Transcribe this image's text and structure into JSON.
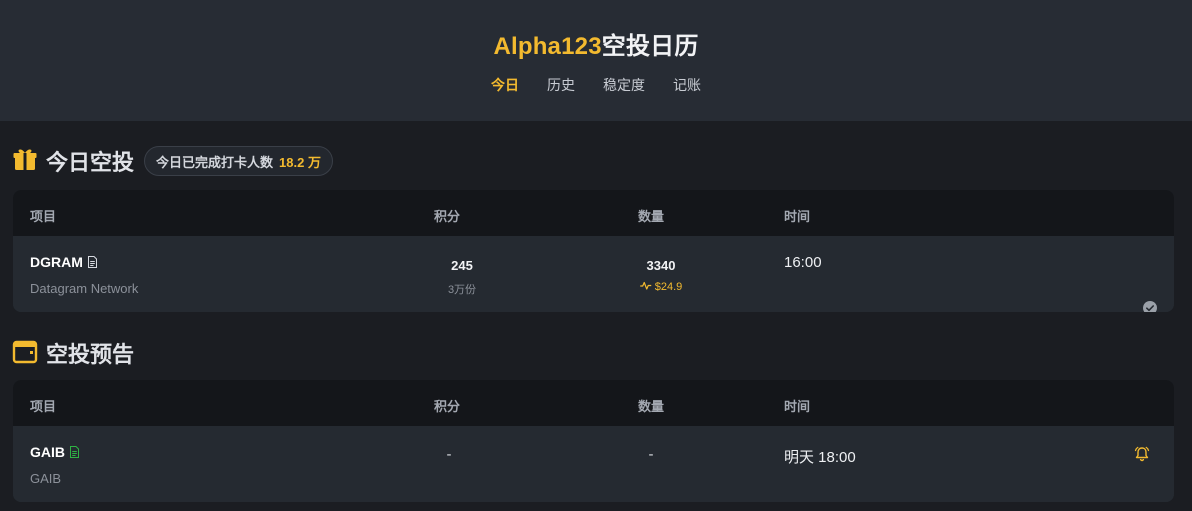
{
  "header": {
    "brand_accent": "Alpha123",
    "brand_rest": "空投日历",
    "tabs": [
      {
        "label": "今日",
        "active": true
      },
      {
        "label": "历史",
        "active": false
      },
      {
        "label": "稳定度",
        "active": false
      },
      {
        "label": "记账",
        "active": false
      }
    ]
  },
  "today": {
    "title": "今日空投",
    "icon": "gift-icon",
    "badge_label": "今日已完成打卡人数",
    "badge_value": "18.2 万",
    "columns": [
      "项目",
      "积分",
      "数量",
      "时间"
    ],
    "rows": [
      {
        "symbol": "DGRAM",
        "name": "Datagram Network",
        "points": "245",
        "points_sub": "3万份",
        "quantity": "3340",
        "value": "$24.9",
        "time": "16:00",
        "status_icon": "check-circle-icon"
      }
    ]
  },
  "upcoming": {
    "title": "空投预告",
    "icon": "calendar-icon",
    "columns": [
      "项目",
      "积分",
      "数量",
      "时间"
    ],
    "rows": [
      {
        "symbol": "GAIB",
        "name": "GAIB",
        "points": "-",
        "quantity": "-",
        "time": "明天 18:00",
        "action_icon": "bell-icon"
      }
    ]
  },
  "colors": {
    "accent": "#f3ba2f",
    "doc_green": "#2fb344",
    "header_bg": "#272c34",
    "page_bg": "#1b1d22"
  }
}
